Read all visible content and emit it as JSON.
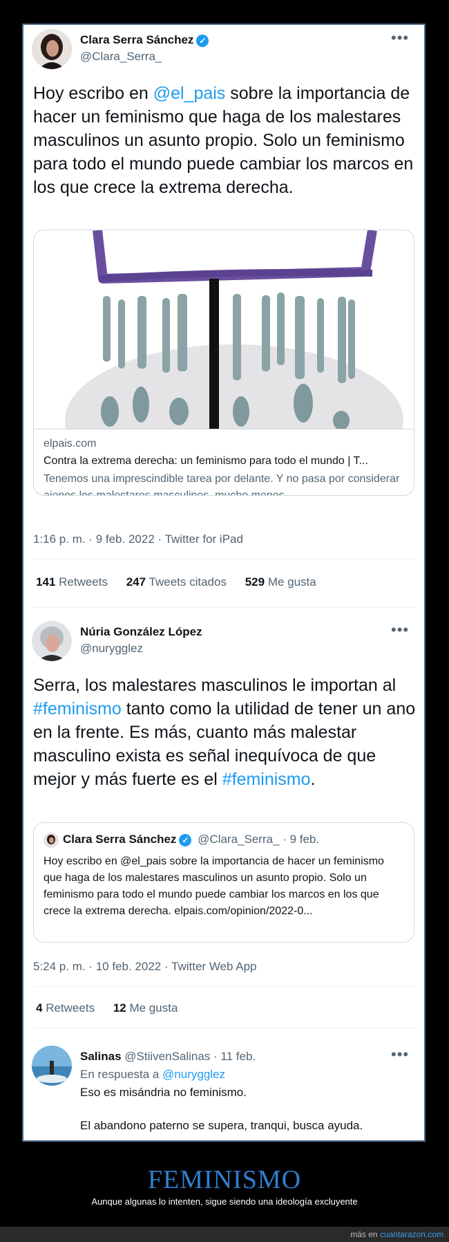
{
  "tweet1": {
    "name": "Clara Serra Sánchez",
    "handle": "@Clara_Serra_",
    "text_before_mention": "Hoy escribo en ",
    "mention": "@el_pais",
    "text_after_mention": " sobre la importancia de hacer un feminismo que haga de los malestares masculinos un asunto propio. Solo un feminismo para todo el mundo puede cambiar los marcos en los que crece la extrema derecha.",
    "card": {
      "domain": "elpais.com",
      "title": "Contra la extrema derecha: un feminismo para todo el mundo | T...",
      "description": "Tenemos una imprescindible tarea por delante. Y no pasa por considerar ajenos los malestares masculinos, mucho menos ..."
    },
    "timestamp": "1:16 p. m. · 9 feb. 2022 · Twitter for iPad",
    "retweets_count": "141",
    "retweets_label": "Retweets",
    "quotes_count": "247",
    "quotes_label": "Tweets citados",
    "likes_count": "529",
    "likes_label": "Me gusta"
  },
  "tweet2": {
    "name": "Núria González López",
    "handle": "@nurygglez",
    "text_a": "Serra, los malestares masculinos le importan al ",
    "hashtag1": "#feminismo",
    "text_b": " tanto como la utilidad de tener un ano en la frente. Es más, cuanto más malestar masculino exista es señal inequívoca de que mejor y más fuerte es el ",
    "hashtag2": "#feminismo",
    "text_c": ".",
    "quoted": {
      "name": "Clara Serra Sánchez",
      "handle_date": "@Clara_Serra_ · 9 feb.",
      "text": "Hoy escribo en @el_pais sobre la importancia de hacer un feminismo que haga de los malestares masculinos un asunto propio. Solo un feminismo para todo el mundo puede cambiar los marcos en los que crece la extrema derecha. elpais.com/opinion/2022-0..."
    },
    "timestamp": "5:24 p. m. · 10 feb. 2022 · Twitter Web App",
    "retweets_count": "4",
    "retweets_label": "Retweets",
    "likes_count": "12",
    "likes_label": "Me gusta"
  },
  "tweet3": {
    "name": "Salinas",
    "handle_date": "@StiivenSalinas · 11 feb.",
    "reply_prefix": "En respuesta a ",
    "reply_to": "@nurygglez",
    "line1": "Eso es misándria no feminismo.",
    "line2": "El abandono paterno se supera, tranqui, busca ayuda."
  },
  "caption": {
    "title": "FEMINISMO",
    "subtitle": "Aunque algunas lo intenten, sigue siendo una ideología excluyente"
  },
  "footer": {
    "prefix": "más en ",
    "site": "cuantarazon.com"
  },
  "colors": {
    "accent": "#1d9bf0",
    "caption_title": "#2f7fd0",
    "footer_link": "#3b9be8"
  },
  "icons": {
    "more": "more-horizontal-icon",
    "verified": "verified-badge-icon"
  }
}
